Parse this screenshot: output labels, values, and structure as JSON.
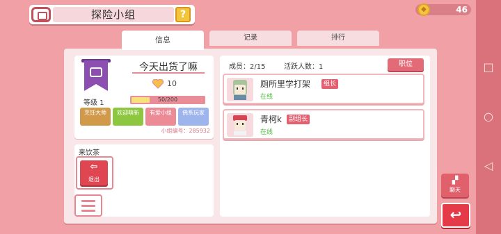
{
  "header": {
    "title": "探险小组",
    "help_label": "?",
    "coins": "46"
  },
  "tabs": [
    {
      "label": "信息"
    },
    {
      "label": "记录"
    },
    {
      "label": "排行"
    }
  ],
  "group": {
    "name": "今天出货了嘛",
    "score": "10",
    "level_label": "等级 1",
    "xp_text": "50/200",
    "xp_progress": 0.25,
    "tags": [
      {
        "label": "烹饪大师",
        "color": "#d1994a"
      },
      {
        "label": "欢迎萌新",
        "color": "#8dc63f"
      },
      {
        "label": "有爱小组",
        "color": "#ec8b96"
      },
      {
        "label": "佛系玩家",
        "color": "#9eb4ec"
      }
    ],
    "group_id": "小组编号：285932",
    "notice": "来饮茶"
  },
  "buttons": {
    "exit_label": "退出",
    "rank_label": "职位",
    "chat_label": "聊天"
  },
  "members": {
    "count_text": "成员：2/15",
    "active_text": "活跃人数：1",
    "list": [
      {
        "name": "厕所里学打架",
        "role": "组长",
        "status": "在线"
      },
      {
        "name": "青柯k",
        "role": "副组长",
        "status": "在线"
      }
    ]
  },
  "colors": {
    "accent": "#e36b77",
    "background": "#f1a0a6",
    "online": "#4dbb3b"
  }
}
